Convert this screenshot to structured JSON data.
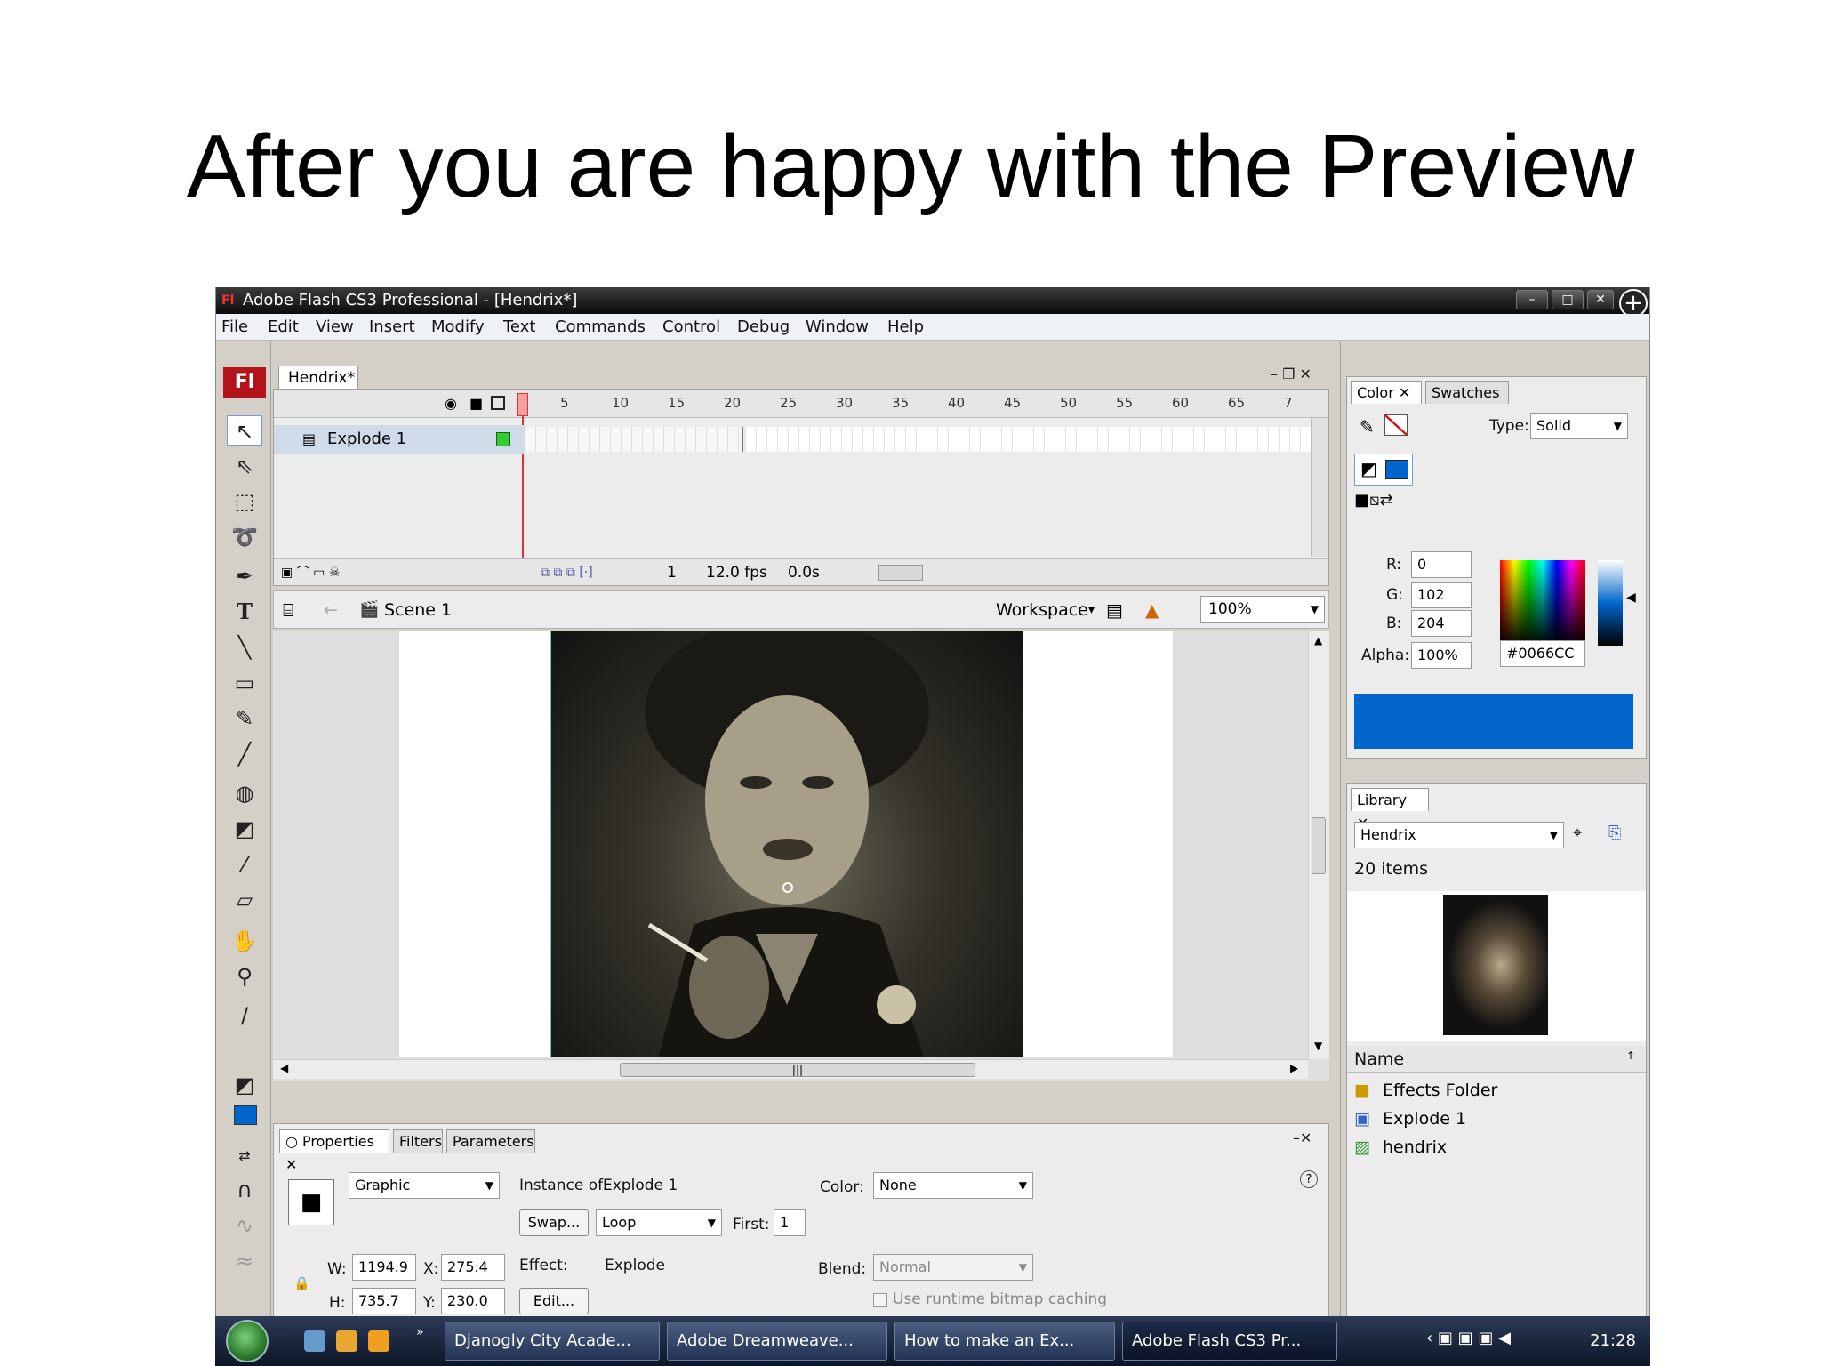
{
  "slide": {
    "title": "After you are happy with the Preview"
  },
  "window": {
    "title": "Adobe Flash CS3 Professional - [Hendrix*]",
    "app_icon": "Fl",
    "menu": [
      "File",
      "Edit",
      "View",
      "Insert",
      "Modify",
      "Text",
      "Commands",
      "Control",
      "Debug",
      "Window",
      "Help"
    ]
  },
  "toolbox": {
    "logo": "Fl"
  },
  "document": {
    "tab": "Hendrix*",
    "timeline": {
      "frame_numbers": [
        "5",
        "10",
        "15",
        "20",
        "25",
        "30",
        "35",
        "40",
        "45",
        "50",
        "55",
        "60",
        "65",
        "7"
      ],
      "layer_name": "Explode 1",
      "current_frame": "1",
      "fps": "12.0 fps",
      "time": "0.0s"
    },
    "editbar": {
      "scene": "Scene 1",
      "workspace": "Workspace",
      "zoom": "100%"
    }
  },
  "properties": {
    "tabs": [
      "Properties",
      "Filters",
      "Parameters"
    ],
    "symbol_type": "Graphic",
    "instance_of_label": "Instance of:",
    "instance_of": "Explode 1",
    "swap_button": "Swap...",
    "loop": "Loop",
    "first_label": "First:",
    "first": "1",
    "color_label": "Color:",
    "color": "None",
    "w_label": "W:",
    "w": "1194.9",
    "x_label": "X:",
    "x": "275.4",
    "h_label": "H:",
    "h": "735.7",
    "y_label": "Y:",
    "y": "230.0",
    "effect_label": "Effect:",
    "effect": "Explode",
    "edit_button": "Edit...",
    "blend_label": "Blend:",
    "blend": "Normal",
    "bitmap_caching": "Use runtime bitmap caching"
  },
  "color_panel": {
    "tabs": [
      "Color",
      "Swatches"
    ],
    "type_label": "Type:",
    "type": "Solid",
    "r_label": "R:",
    "r": "0",
    "g_label": "G:",
    "g": "102",
    "b_label": "B:",
    "b": "204",
    "alpha_label": "Alpha:",
    "alpha": "100%",
    "hex": "#0066CC"
  },
  "library": {
    "tab": "Library",
    "document": "Hendrix",
    "count": "20 items",
    "name_header": "Name",
    "items": [
      "Effects Folder",
      "Explode 1",
      "hendrix"
    ]
  },
  "taskbar": {
    "tasks": [
      "Djanogly City Acade...",
      "Adobe Dreamweave...",
      "How to make an Ex...",
      "Adobe Flash CS3 Pr..."
    ],
    "clock": "21:28"
  },
  "colors": {
    "accent_blue": "#0066CC",
    "flash_red": "#b3131b"
  }
}
